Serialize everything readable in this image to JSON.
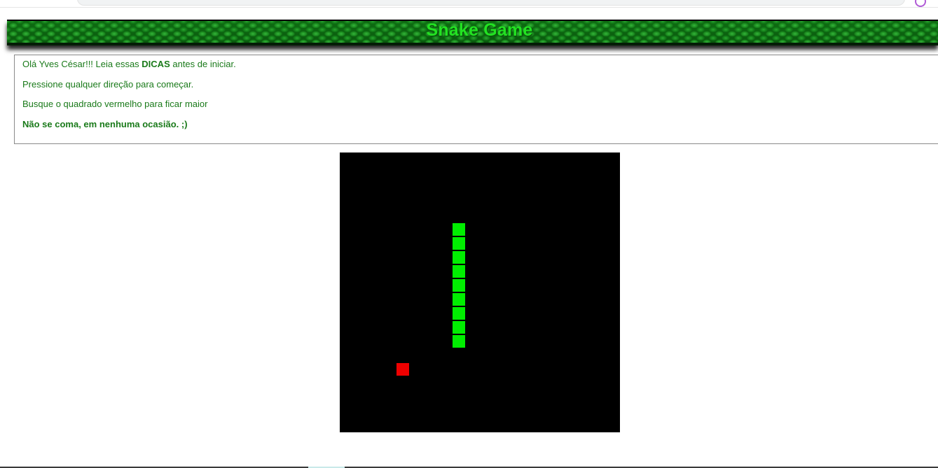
{
  "header": {
    "title": "Snake Game"
  },
  "tips": {
    "greeting": "Olá Yves César!!! Leia essas ",
    "greeting_bold": "DICAS",
    "greeting_end": " antes de iniciar.",
    "line2": "Pressione qualquer direção para começar.",
    "line3": "Busque o quadrado vermelho para ficar maior",
    "line4": "Não se coma, em nenhuma ocasião. ;)"
  },
  "game": {
    "grid_size": 20,
    "snake": [
      {
        "col": 8,
        "row": 5
      },
      {
        "col": 8,
        "row": 6
      },
      {
        "col": 8,
        "row": 7
      },
      {
        "col": 8,
        "row": 8
      },
      {
        "col": 8,
        "row": 9
      },
      {
        "col": 8,
        "row": 10
      },
      {
        "col": 8,
        "row": 11
      },
      {
        "col": 8,
        "row": 12
      },
      {
        "col": 8,
        "row": 13
      }
    ],
    "food": {
      "col": 4,
      "row": 15
    },
    "colors": {
      "background": "#000000",
      "snake": "#00ee00",
      "food": "#ee0000"
    }
  }
}
